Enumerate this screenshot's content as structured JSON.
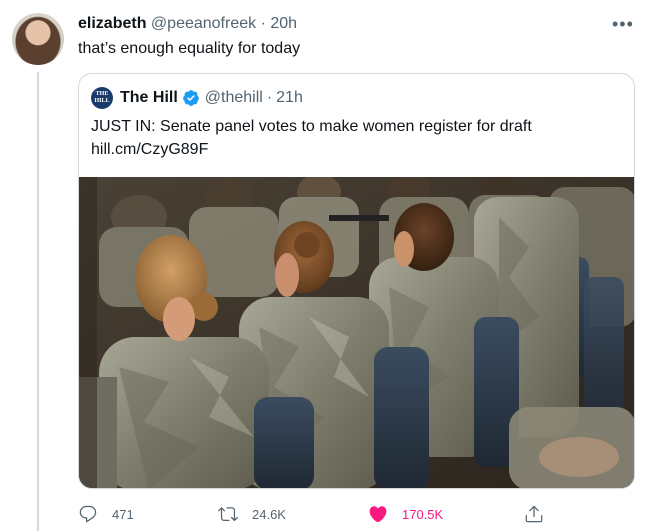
{
  "tweet": {
    "author_name": "elizabeth",
    "author_handle": "@peeanofreek",
    "separator": "·",
    "time": "20h",
    "text": "that’s enough equality for today",
    "more_icon": "more-dots-icon"
  },
  "quoted_tweet": {
    "logo_text_top": "THE",
    "logo_text_bottom": "HILL",
    "author_name": "The Hill",
    "verified": true,
    "author_handle": "@thehill",
    "separator": "·",
    "time": "21h",
    "text": "JUST IN: Senate panel votes to make women register for draft",
    "link": "hill.cm/CzyG89F",
    "image_subject": "rows of seated soldiers in camouflage uniforms, women with hair in buns in the foreground"
  },
  "actions": {
    "reply_count": "471",
    "retweet_count": "24.6K",
    "like_count": "170.5K",
    "liked": true,
    "icons": [
      "reply-icon",
      "retweet-icon",
      "heart-icon",
      "share-icon"
    ]
  },
  "colors": {
    "text_primary": "#0f1419",
    "text_secondary": "#536471",
    "verified_blue": "#1d9bf0",
    "like_pink": "#f91880",
    "border": "#cfd9de"
  }
}
